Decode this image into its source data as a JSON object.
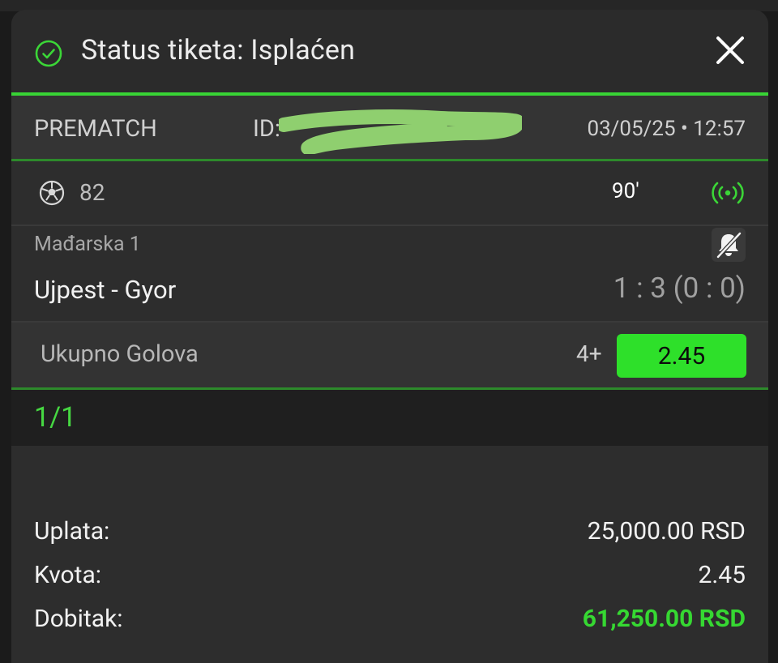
{
  "ticket": {
    "status_text": "Status tiketa: Isplaćen",
    "type": "PREMATCH",
    "id_label": "ID:",
    "datetime": "03/05/25 • 12:57"
  },
  "live": {
    "sport_count": "82",
    "minute": "90′"
  },
  "event": {
    "league": "Mađarska 1",
    "teams": "Ujpest - Gyor",
    "score": "1 : 3 (0 : 0)",
    "market": "Ukupno Golova",
    "pick": "4+",
    "odds": "2.45"
  },
  "counter": "1/1",
  "summary": {
    "stake_label": "Uplata:",
    "stake_value": "25,000.00 RSD",
    "odds_label": "Kvota:",
    "odds_value": "2.45",
    "win_label": "Dobitak:",
    "win_value": "61,250.00 RSD"
  },
  "colors": {
    "accent_green": "#38d435",
    "background": "#2d2d2d"
  },
  "icons": [
    "check-circle-icon",
    "close-icon",
    "soccer-ball-icon",
    "live-broadcast-icon",
    "bell-off-icon"
  ]
}
